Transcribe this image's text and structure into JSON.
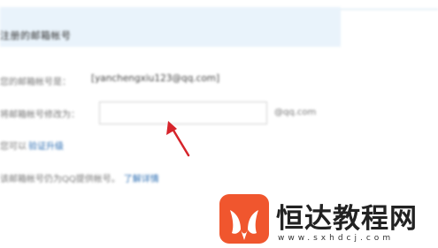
{
  "header": {
    "title": "注册的邮箱帐号"
  },
  "form": {
    "current_label": "您的邮箱帐号是：",
    "current_email": "[yanchengxiu123@qq.com]",
    "new_label": "将邮箱帐号修改为：",
    "new_value": "",
    "domain_suffix": "@qq.com",
    "verify_prefix": "您可以",
    "verify_link": "验证升级",
    "note_text": "该邮箱帐号仍为QQ提供帐号。",
    "learn_more": "了解详情"
  },
  "watermark": {
    "name": "恒达教程网",
    "url": "www.sxhdcj.com"
  },
  "colors": {
    "header_bg": "#e9f3fb",
    "link": "#2e6fb3",
    "arrow": "#d6242b",
    "logo": "#f0562e"
  }
}
